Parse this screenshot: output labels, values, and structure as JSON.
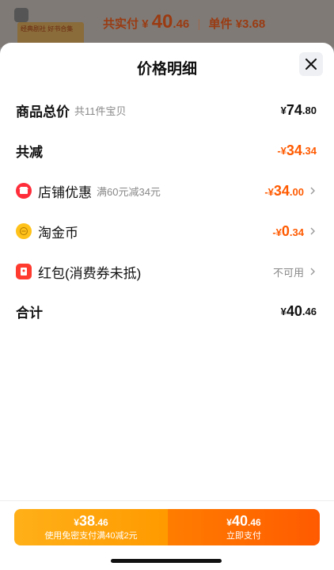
{
  "background": {
    "total_label": "共实付",
    "total_currency": "¥",
    "total_int": "40",
    "total_dec": ".46",
    "unit_label": "单件",
    "unit_price": "¥3.68",
    "card_text": "经典剧社 好书合集"
  },
  "sheet": {
    "title": "价格明细",
    "close_icon": "close-icon"
  },
  "rows": {
    "goods_total": {
      "label": "商品总价",
      "sub": "共11件宝贝",
      "currency": "¥",
      "int": "74",
      "dec": ".80"
    },
    "discount_total": {
      "label": "共减",
      "currency": "-¥",
      "int": "34",
      "dec": ".34"
    },
    "shop_discount": {
      "icon": "shop-icon",
      "label": "店铺优惠",
      "sub": "满60元减34元",
      "currency": "-¥",
      "int": "34",
      "dec": ".00"
    },
    "taojinbi": {
      "icon": "coin-icon",
      "label": "淘金币",
      "currency": "-¥",
      "int": "0",
      "dec": ".34"
    },
    "red_packet": {
      "icon": "red-packet-icon",
      "label": "红包(消费券未抵)",
      "status": "不可用"
    },
    "sum": {
      "label": "合计",
      "currency": "¥",
      "int": "40",
      "dec": ".46"
    }
  },
  "bottom": {
    "left": {
      "currency": "¥",
      "int": "38",
      "dec": ".46",
      "sub": "使用免密支付满40减2元"
    },
    "right": {
      "currency": "¥",
      "int": "40",
      "dec": ".46",
      "sub": "立即支付"
    }
  },
  "colors": {
    "accent": "#ff5a00",
    "button_left": "#ffa00d",
    "button_right": "#ff6a00"
  }
}
